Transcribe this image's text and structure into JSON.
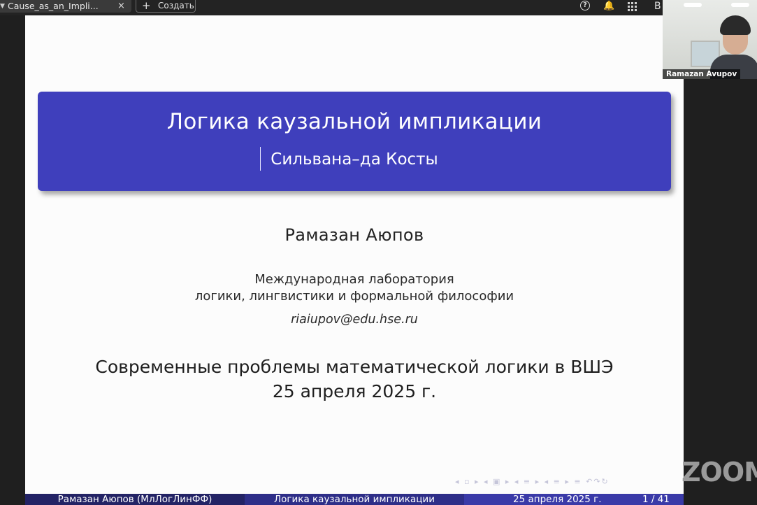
{
  "toolbar": {
    "tab_title": "Cause_as_an_Impli...",
    "tab_close": "×",
    "tab_icon": "▼",
    "create_plus": "+",
    "create_label": "Создать",
    "help_icon": "?",
    "bell_icon": "🔔",
    "user_initial": "B"
  },
  "slide": {
    "title": "Логика каузальной импликации",
    "subtitle": "Сильвана–да Косты",
    "author": "Рамазан Аюпов",
    "affiliation_line1": "Международная лаборатория",
    "affiliation_line2": "логики, лингвистики и формальной философии",
    "email": "riaiupov@edu.hse.ru",
    "event": "Современные проблемы математической логики в ВШЭ",
    "date": "25 апреля 2025 г.",
    "nav_symbols": "◂ ▫ ▸ ◂ ▣ ▸ ◂ ≡ ▸ ◂ ≡ ▸ ≡ ↶↷↻",
    "footer": {
      "author": "Рамазан Аюпов (МлЛогЛинФФ)",
      "title": "Логика каузальной импликации",
      "date": "25 апреля 2025 г.",
      "page": "1 / 41"
    },
    "colors": {
      "title_box": "#3f3fbc",
      "footer_left": "#232365",
      "footer_mid": "#2e2e88",
      "footer_right": "#3a3aa8"
    }
  },
  "webcam": {
    "participant_name": "Ramazan Avupov"
  },
  "app_logo": "ZOOM"
}
